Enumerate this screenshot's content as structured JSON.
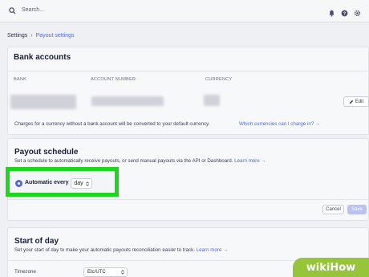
{
  "topbar": {
    "search_placeholder": "Search…"
  },
  "breadcrumb": {
    "root": "Settings",
    "separator": "›",
    "current": "Payout settings"
  },
  "bank_accounts": {
    "title": "Bank accounts",
    "columns": [
      "BANK",
      "ACCOUNT NUMBER",
      "CURRENCY"
    ],
    "edit_label": "Edit",
    "note": "Charges for a currency without a bank account will be converted to your default currency.",
    "note_link": "Which currencies can I charge in? →"
  },
  "payout_schedule": {
    "title": "Payout schedule",
    "description": "Set a schedule to automatically receive payouts, or send manual payouts via the API or Dashboard.",
    "learn_more": "Learn more →",
    "option_label": "Automatic every",
    "interval_value": "day",
    "cancel_label": "Cancel",
    "save_label": "Save"
  },
  "start_of_day": {
    "title": "Start of day",
    "description": "Set your start of day to make your automatic payouts reconciliation easier to track.",
    "learn_more": "Learn more →",
    "timezone_label": "Timezone",
    "timezone_value": "Etc/UTC"
  },
  "watermark": {
    "part1": "wiki",
    "part2": "How"
  },
  "colors": {
    "accent": "#5469d4",
    "highlight": "#1fd51f",
    "watermark_bg": "#96c43a"
  }
}
